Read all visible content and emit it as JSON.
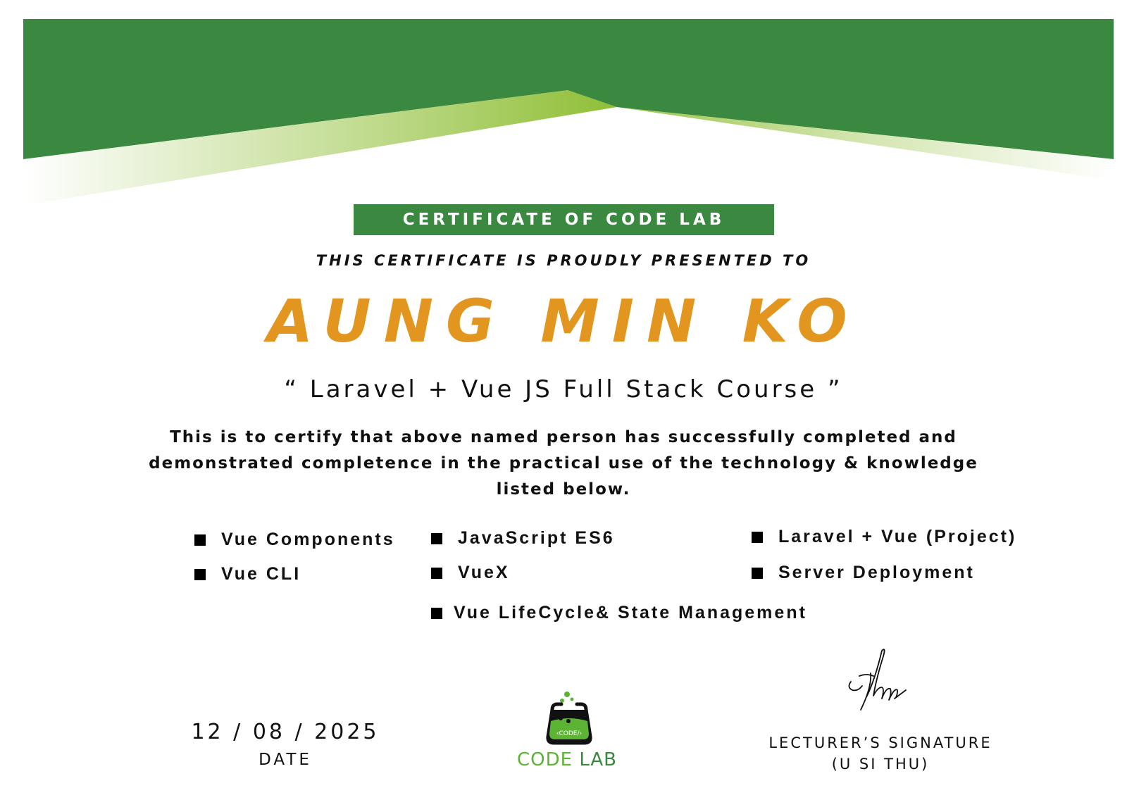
{
  "colors": {
    "brand_green": "#3b8841",
    "light_green": "#8fbf36",
    "name_orange": "#e3961f",
    "text_dark": "#111111"
  },
  "certificate": {
    "title": "CERTIFICATE OF CODE LAB",
    "presented_line": "THIS CERTIFICATE IS PROUDLY PRESENTED TO",
    "recipient_name": "AUNG MIN KO",
    "course_name": "“ Laravel + Vue JS Full Stack Course ”",
    "statement": "This is to certify that above named person has successfully completed and demonstrated completence in the practical use of the technology & knowledge listed below.",
    "skills": [
      "Vue Components",
      "Vue CLI",
      "JavaScript ES6",
      "VueX",
      "Vue LifeCycle& State Management",
      "Laravel + Vue (Project)",
      "Server Deployment"
    ]
  },
  "footer": {
    "date_value": "12 / 08 / 2025",
    "date_label": "DATE",
    "logo": {
      "badge_text": "‹CODE/›",
      "brand_code": "CODE",
      "brand_lab": "LAB",
      "icon": "code-lab-flask-icon"
    },
    "signature_label": "LECTURER’S SIGNATURE",
    "signature_name": "(U SI THU)"
  }
}
